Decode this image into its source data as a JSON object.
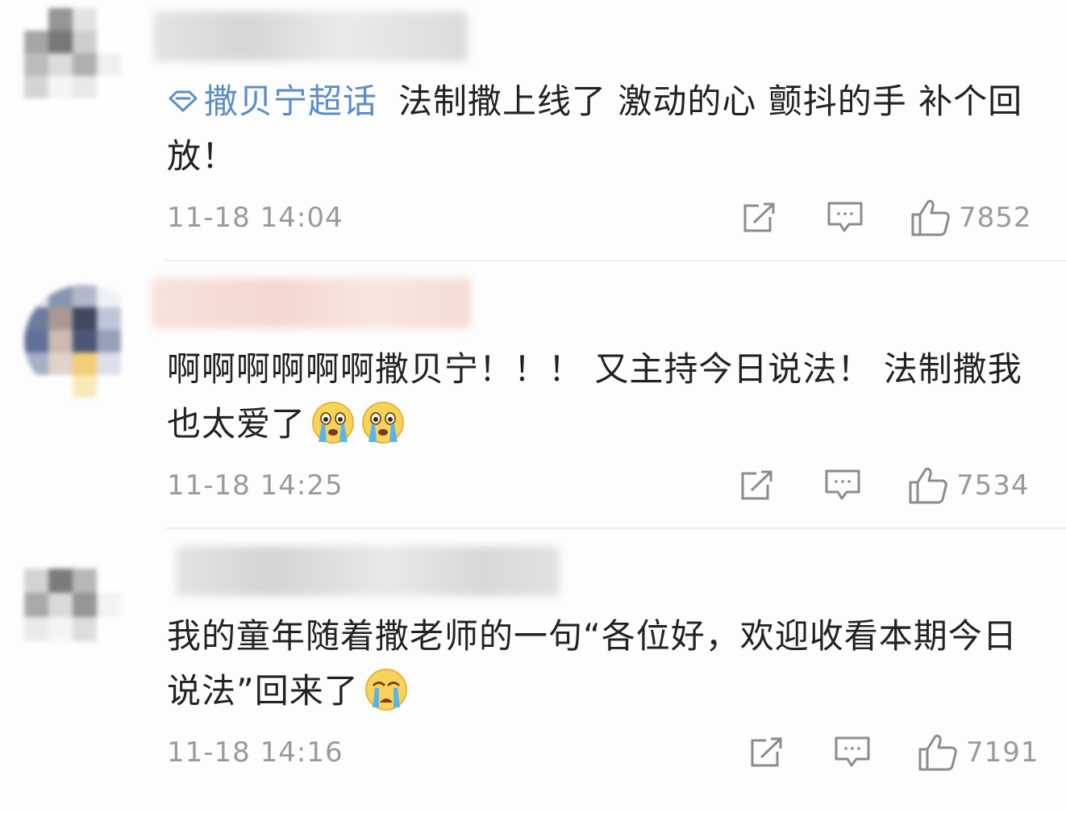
{
  "comments": [
    {
      "topic": "撒贝宁超话",
      "text": "法制撒上线了 激动的心 颤抖的手 补个回放！",
      "timestamp": "11-18 14:04",
      "likes": "7852",
      "emojis": []
    },
    {
      "topic": "",
      "text": "啊啊啊啊啊啊撒贝宁！！！ 又主持今日说法！ 法制撒我也太爱了",
      "timestamp": "11-18 14:25",
      "likes": "7534",
      "emojis": [
        "crying-face",
        "crying-face"
      ]
    },
    {
      "topic": "",
      "text": "我的童年随着撒老师的一句“各位好，欢迎收看本期今日说法”回来了",
      "timestamp": "11-18 14:16",
      "likes": "7191",
      "emojis": [
        "crying-face"
      ]
    }
  ],
  "icons": {
    "topic": "super-topic-diamond-icon",
    "repost": "repost-icon",
    "comment": "comment-icon",
    "like": "thumbs-up-icon",
    "emoji": "crying-face-emoji"
  },
  "colors": {
    "topic_link": "#5a8dc8",
    "meta_gray": "#9a9a9a",
    "text": "#222222"
  }
}
